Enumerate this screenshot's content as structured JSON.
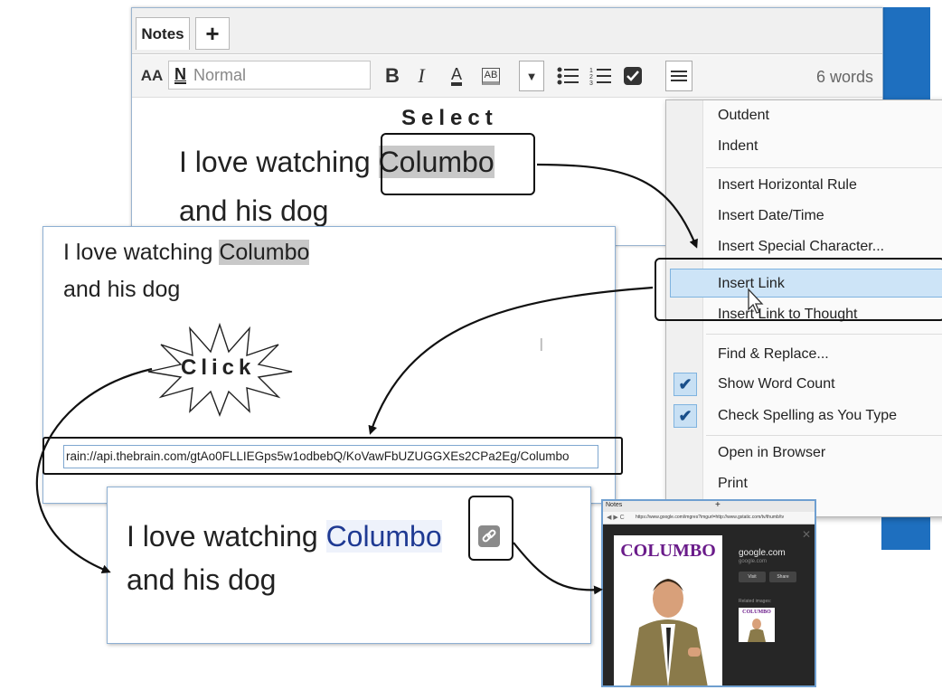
{
  "tabs": {
    "notes_label": "Notes",
    "add_label": "+"
  },
  "toolbar": {
    "font_size_label": "AA",
    "style_icon_letter": "N",
    "style_value": "Normal",
    "bold": "B",
    "italic": "I",
    "font_color": "A",
    "highlight": "AB",
    "word_count": "6 words"
  },
  "editor": {
    "select_caption": "Select",
    "line1_prefix": "I love watching ",
    "selected_word": "Columbo",
    "line2": "and his dog"
  },
  "menu": {
    "items": [
      {
        "label": "Outdent"
      },
      {
        "label": "Indent"
      },
      {
        "label": "Insert Horizontal Rule"
      },
      {
        "label": "Insert Date/Time"
      },
      {
        "label": "Insert Special Character..."
      },
      {
        "label": "Insert Link"
      },
      {
        "label": "Insert Link to Thought"
      },
      {
        "label": "Find & Replace..."
      },
      {
        "label": "Show Word Count",
        "checked": true
      },
      {
        "label": "Check Spelling as You Type",
        "checked": true
      },
      {
        "label": "Open in Browser"
      },
      {
        "label": "Print"
      }
    ]
  },
  "panel2": {
    "line1_prefix": "I love watching ",
    "selected_word": "Columbo",
    "line2": "and his dog",
    "click_caption": "Click",
    "link_value": "rain://api.thebrain.com/gtAo0FLLIEGps5w1odbebQ/KoVawFbUZUGGXEs2CPa2Eg/Columbo"
  },
  "panel3": {
    "line1_prefix": "I love watching ",
    "link_word": "Columbo",
    "line2": "and his dog",
    "link_icon": "link-icon"
  },
  "browser": {
    "tab_label": "Notes",
    "new_tab": "+",
    "url": "https://www.google.com/imgres?imgurl=http://www.gstatic.com/tv/thumb/tv",
    "poster_title": "COLUMBO",
    "site_title": "google.com",
    "site_sub": "google.com",
    "visit_label": "Visit",
    "share_label": "Share",
    "related_label": "Related images:",
    "related_title": "COLUMBO"
  },
  "colors": {
    "accent_blue": "#1e6fbf",
    "selection_gray": "#c8c8c8",
    "link_blue": "#1f3a93",
    "menu_highlight": "#cde4f7"
  }
}
